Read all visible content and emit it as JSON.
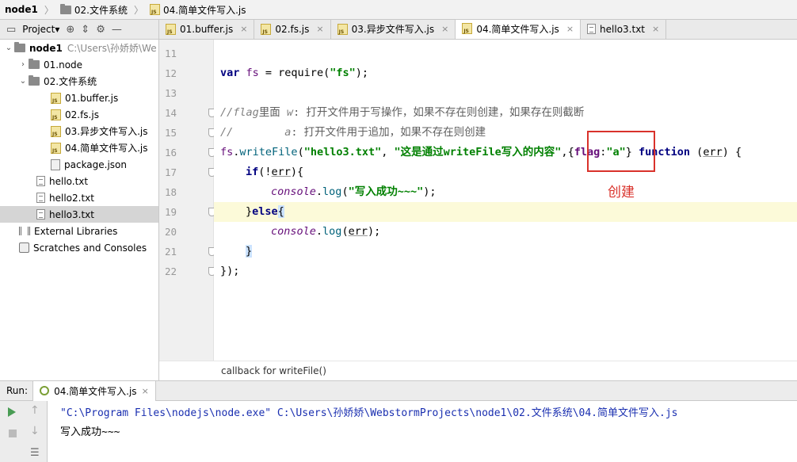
{
  "breadcrumb": {
    "project": "node1",
    "folder": "02.文件系统",
    "file": "04.简单文件写入.js"
  },
  "project_panel": {
    "title": "Project",
    "tree": [
      {
        "label": "node1",
        "path": "C:\\Users\\孙娇娇\\We",
        "type": "folder",
        "expanded": true,
        "bold": true,
        "level": 0
      },
      {
        "label": "01.node",
        "type": "folder",
        "expanded": false,
        "level": 1
      },
      {
        "label": "02.文件系统",
        "type": "folder",
        "expanded": true,
        "level": 1
      },
      {
        "label": "01.buffer.js",
        "type": "js",
        "level": 2
      },
      {
        "label": "02.fs.js",
        "type": "js",
        "level": 2
      },
      {
        "label": "03.异步文件写入.js",
        "type": "js",
        "level": 2
      },
      {
        "label": "04.简单文件写入.js",
        "type": "js",
        "level": 2
      },
      {
        "label": "package.json",
        "type": "json",
        "level": 2
      },
      {
        "label": "hello.txt",
        "type": "txt",
        "level": 1
      },
      {
        "label": "hello2.txt",
        "type": "txt",
        "level": 1
      },
      {
        "label": "hello3.txt",
        "type": "txt",
        "level": 1,
        "selected": true
      },
      {
        "label": "External Libraries",
        "type": "lib",
        "level": 0
      },
      {
        "label": "Scratches and Consoles",
        "type": "scratch",
        "level": 0
      }
    ]
  },
  "editor_tabs": [
    {
      "label": "01.buffer.js",
      "type": "js"
    },
    {
      "label": "02.fs.js",
      "type": "js"
    },
    {
      "label": "03.异步文件写入.js",
      "type": "js"
    },
    {
      "label": "04.简单文件写入.js",
      "type": "js",
      "active": true
    },
    {
      "label": "hello3.txt",
      "type": "txt"
    }
  ],
  "editor": {
    "line_numbers": [
      "11",
      "12",
      "13",
      "14",
      "15",
      "16",
      "17",
      "18",
      "19",
      "20",
      "21",
      "22"
    ],
    "code": {
      "l12_var": "var",
      "l12_name": " fs",
      "l12_eq": " = ",
      "l12_req": "require",
      "l12_open": "(",
      "l12_str": "\"fs\"",
      "l12_close": ");",
      "l14_a": "//flag",
      "l14_b": "里面 ",
      "l14_c": "w",
      "l14_d": ": 打开文件用于写操作，如果不存在则创建，如果存在则截断",
      "l15_a": "//        ",
      "l15_c": "a",
      "l15_d": ": 打开文件用于追加，如果不存在则创建",
      "l16_fs": "fs",
      "l16_dot": ".",
      "l16_fn": "writeFile",
      "l16_open": "(",
      "l16_s1": "\"hello3.txt\"",
      "l16_comma": ", ",
      "l16_s2": "\"这是通过writeFile写入的内容\"",
      "l16_comma2": ",",
      "l16_brace1": "{",
      "l16_flag": "flag",
      "l16_colon": ":",
      "l16_a": "\"a\"",
      "l16_brace2": "}",
      "l16_function": " function",
      "l16_sp": " (",
      "l16_err": "err",
      "l16_tail": ") {",
      "l17_if": "if",
      "l17_a": "(!",
      "l17_err": "err",
      "l17_b": "){",
      "l18_console": "console",
      "l18_dot": ".",
      "l18_log": "log",
      "l18_open": "(",
      "l18_str": "\"写入成功~~~\"",
      "l18_close": ");",
      "l19_a": "}",
      "l19_else": "else",
      "l19_b": "{",
      "l20_console": "console",
      "l20_dot": ".",
      "l20_log": "log",
      "l20_open": "(",
      "l20_err": "err",
      "l20_close": ");",
      "l21": "}",
      "l22": "});"
    },
    "annotation": "创建",
    "breadcrumb_hint": "callback for writeFile()"
  },
  "run_panel": {
    "label": "Run:",
    "tab": "04.简单文件写入.js",
    "command": "\"C:\\Program Files\\nodejs\\node.exe\" C:\\Users\\孙娇娇\\WebstormProjects\\node1\\02.文件系统\\04.简单文件写入.js",
    "output": "写入成功~~~"
  }
}
